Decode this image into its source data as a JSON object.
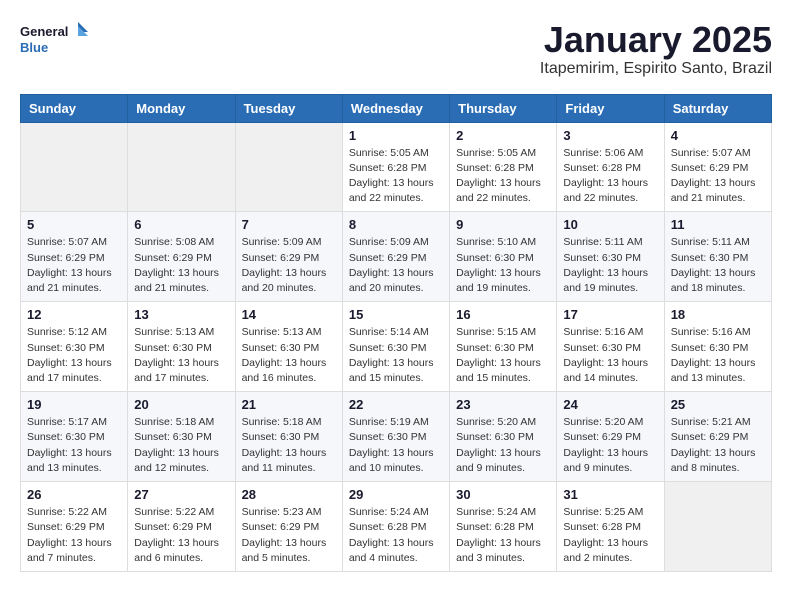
{
  "logo": {
    "line1": "General",
    "line2": "Blue"
  },
  "header": {
    "title": "January 2025",
    "subtitle": "Itapemirim, Espirito Santo, Brazil"
  },
  "weekdays": [
    "Sunday",
    "Monday",
    "Tuesday",
    "Wednesday",
    "Thursday",
    "Friday",
    "Saturday"
  ],
  "weeks": [
    [
      {
        "day": "",
        "info": ""
      },
      {
        "day": "",
        "info": ""
      },
      {
        "day": "",
        "info": ""
      },
      {
        "day": "1",
        "info": "Sunrise: 5:05 AM\nSunset: 6:28 PM\nDaylight: 13 hours\nand 22 minutes."
      },
      {
        "day": "2",
        "info": "Sunrise: 5:05 AM\nSunset: 6:28 PM\nDaylight: 13 hours\nand 22 minutes."
      },
      {
        "day": "3",
        "info": "Sunrise: 5:06 AM\nSunset: 6:28 PM\nDaylight: 13 hours\nand 22 minutes."
      },
      {
        "day": "4",
        "info": "Sunrise: 5:07 AM\nSunset: 6:29 PM\nDaylight: 13 hours\nand 21 minutes."
      }
    ],
    [
      {
        "day": "5",
        "info": "Sunrise: 5:07 AM\nSunset: 6:29 PM\nDaylight: 13 hours\nand 21 minutes."
      },
      {
        "day": "6",
        "info": "Sunrise: 5:08 AM\nSunset: 6:29 PM\nDaylight: 13 hours\nand 21 minutes."
      },
      {
        "day": "7",
        "info": "Sunrise: 5:09 AM\nSunset: 6:29 PM\nDaylight: 13 hours\nand 20 minutes."
      },
      {
        "day": "8",
        "info": "Sunrise: 5:09 AM\nSunset: 6:29 PM\nDaylight: 13 hours\nand 20 minutes."
      },
      {
        "day": "9",
        "info": "Sunrise: 5:10 AM\nSunset: 6:30 PM\nDaylight: 13 hours\nand 19 minutes."
      },
      {
        "day": "10",
        "info": "Sunrise: 5:11 AM\nSunset: 6:30 PM\nDaylight: 13 hours\nand 19 minutes."
      },
      {
        "day": "11",
        "info": "Sunrise: 5:11 AM\nSunset: 6:30 PM\nDaylight: 13 hours\nand 18 minutes."
      }
    ],
    [
      {
        "day": "12",
        "info": "Sunrise: 5:12 AM\nSunset: 6:30 PM\nDaylight: 13 hours\nand 17 minutes."
      },
      {
        "day": "13",
        "info": "Sunrise: 5:13 AM\nSunset: 6:30 PM\nDaylight: 13 hours\nand 17 minutes."
      },
      {
        "day": "14",
        "info": "Sunrise: 5:13 AM\nSunset: 6:30 PM\nDaylight: 13 hours\nand 16 minutes."
      },
      {
        "day": "15",
        "info": "Sunrise: 5:14 AM\nSunset: 6:30 PM\nDaylight: 13 hours\nand 15 minutes."
      },
      {
        "day": "16",
        "info": "Sunrise: 5:15 AM\nSunset: 6:30 PM\nDaylight: 13 hours\nand 15 minutes."
      },
      {
        "day": "17",
        "info": "Sunrise: 5:16 AM\nSunset: 6:30 PM\nDaylight: 13 hours\nand 14 minutes."
      },
      {
        "day": "18",
        "info": "Sunrise: 5:16 AM\nSunset: 6:30 PM\nDaylight: 13 hours\nand 13 minutes."
      }
    ],
    [
      {
        "day": "19",
        "info": "Sunrise: 5:17 AM\nSunset: 6:30 PM\nDaylight: 13 hours\nand 13 minutes."
      },
      {
        "day": "20",
        "info": "Sunrise: 5:18 AM\nSunset: 6:30 PM\nDaylight: 13 hours\nand 12 minutes."
      },
      {
        "day": "21",
        "info": "Sunrise: 5:18 AM\nSunset: 6:30 PM\nDaylight: 13 hours\nand 11 minutes."
      },
      {
        "day": "22",
        "info": "Sunrise: 5:19 AM\nSunset: 6:30 PM\nDaylight: 13 hours\nand 10 minutes."
      },
      {
        "day": "23",
        "info": "Sunrise: 5:20 AM\nSunset: 6:30 PM\nDaylight: 13 hours\nand 9 minutes."
      },
      {
        "day": "24",
        "info": "Sunrise: 5:20 AM\nSunset: 6:29 PM\nDaylight: 13 hours\nand 9 minutes."
      },
      {
        "day": "25",
        "info": "Sunrise: 5:21 AM\nSunset: 6:29 PM\nDaylight: 13 hours\nand 8 minutes."
      }
    ],
    [
      {
        "day": "26",
        "info": "Sunrise: 5:22 AM\nSunset: 6:29 PM\nDaylight: 13 hours\nand 7 minutes."
      },
      {
        "day": "27",
        "info": "Sunrise: 5:22 AM\nSunset: 6:29 PM\nDaylight: 13 hours\nand 6 minutes."
      },
      {
        "day": "28",
        "info": "Sunrise: 5:23 AM\nSunset: 6:29 PM\nDaylight: 13 hours\nand 5 minutes."
      },
      {
        "day": "29",
        "info": "Sunrise: 5:24 AM\nSunset: 6:28 PM\nDaylight: 13 hours\nand 4 minutes."
      },
      {
        "day": "30",
        "info": "Sunrise: 5:24 AM\nSunset: 6:28 PM\nDaylight: 13 hours\nand 3 minutes."
      },
      {
        "day": "31",
        "info": "Sunrise: 5:25 AM\nSunset: 6:28 PM\nDaylight: 13 hours\nand 2 minutes."
      },
      {
        "day": "",
        "info": ""
      }
    ]
  ]
}
